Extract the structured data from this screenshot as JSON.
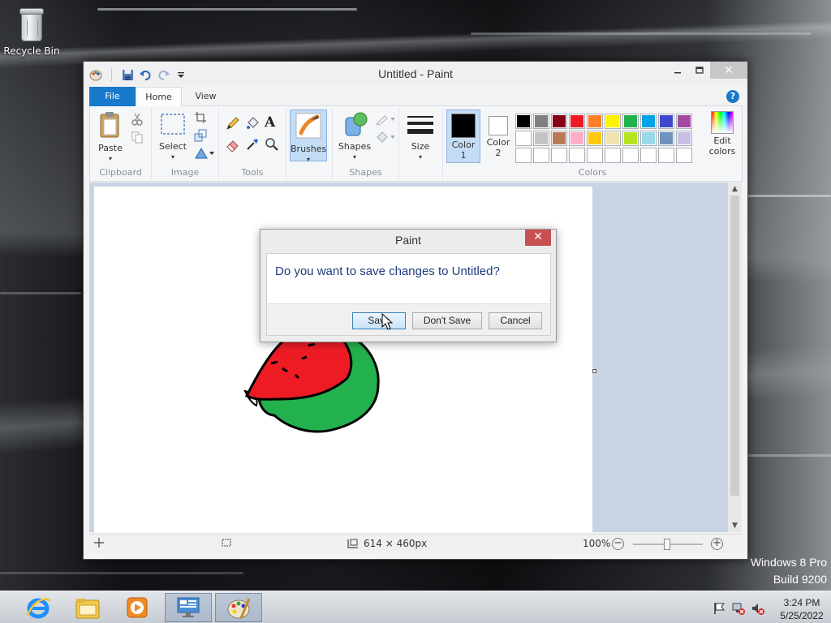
{
  "desktop": {
    "recycle_bin_label": "Recycle Bin",
    "brand_line1": "Windows 8 Pro",
    "brand_line2": "Build 9200"
  },
  "window": {
    "title": "Untitled - Paint"
  },
  "ribbon": {
    "tabs": [
      "File",
      "Home",
      "View"
    ],
    "groups": {
      "clipboard": {
        "label": "Clipboard",
        "paste": "Paste"
      },
      "image": {
        "label": "Image",
        "select": "Select"
      },
      "tools": {
        "label": "Tools"
      },
      "brushes": {
        "label": "Brushes"
      },
      "shapes": {
        "label": "Shapes",
        "shapes_btn": "Shapes"
      },
      "size": {
        "label": "Size"
      },
      "colors": {
        "label": "Colors",
        "color1": "Color",
        "color1_num": "1",
        "color2": "Color",
        "color2_num": "2",
        "edit_colors": "Edit",
        "edit_colors2": "colors"
      }
    },
    "palette_row1": [
      "#000000",
      "#7f7f7f",
      "#880015",
      "#ed1c24",
      "#ff7f27",
      "#fff200",
      "#22b14c",
      "#00a2e8",
      "#3f48cc",
      "#a349a4"
    ],
    "palette_row2": [
      "#ffffff",
      "#c3c3c3",
      "#b97a57",
      "#ffaec9",
      "#ffc90e",
      "#efe4b0",
      "#b5e61d",
      "#99d9ea",
      "#7092be",
      "#c8bfe7"
    ],
    "palette_row3": [
      "",
      "",
      "",
      "",
      "",
      "",
      "",
      "",
      "",
      ""
    ],
    "color1_value": "#000000",
    "color2_value": "#ffffff"
  },
  "statusbar": {
    "dimensions": "614 × 460px",
    "zoom": "100%"
  },
  "dialog": {
    "title": "Paint",
    "message": "Do you want to save changes to Untitled?",
    "save": "Save",
    "dont_save": "Don't Save",
    "cancel": "Cancel"
  },
  "taskbar": {
    "time": "3:24 PM",
    "date": "5/25/2022"
  }
}
